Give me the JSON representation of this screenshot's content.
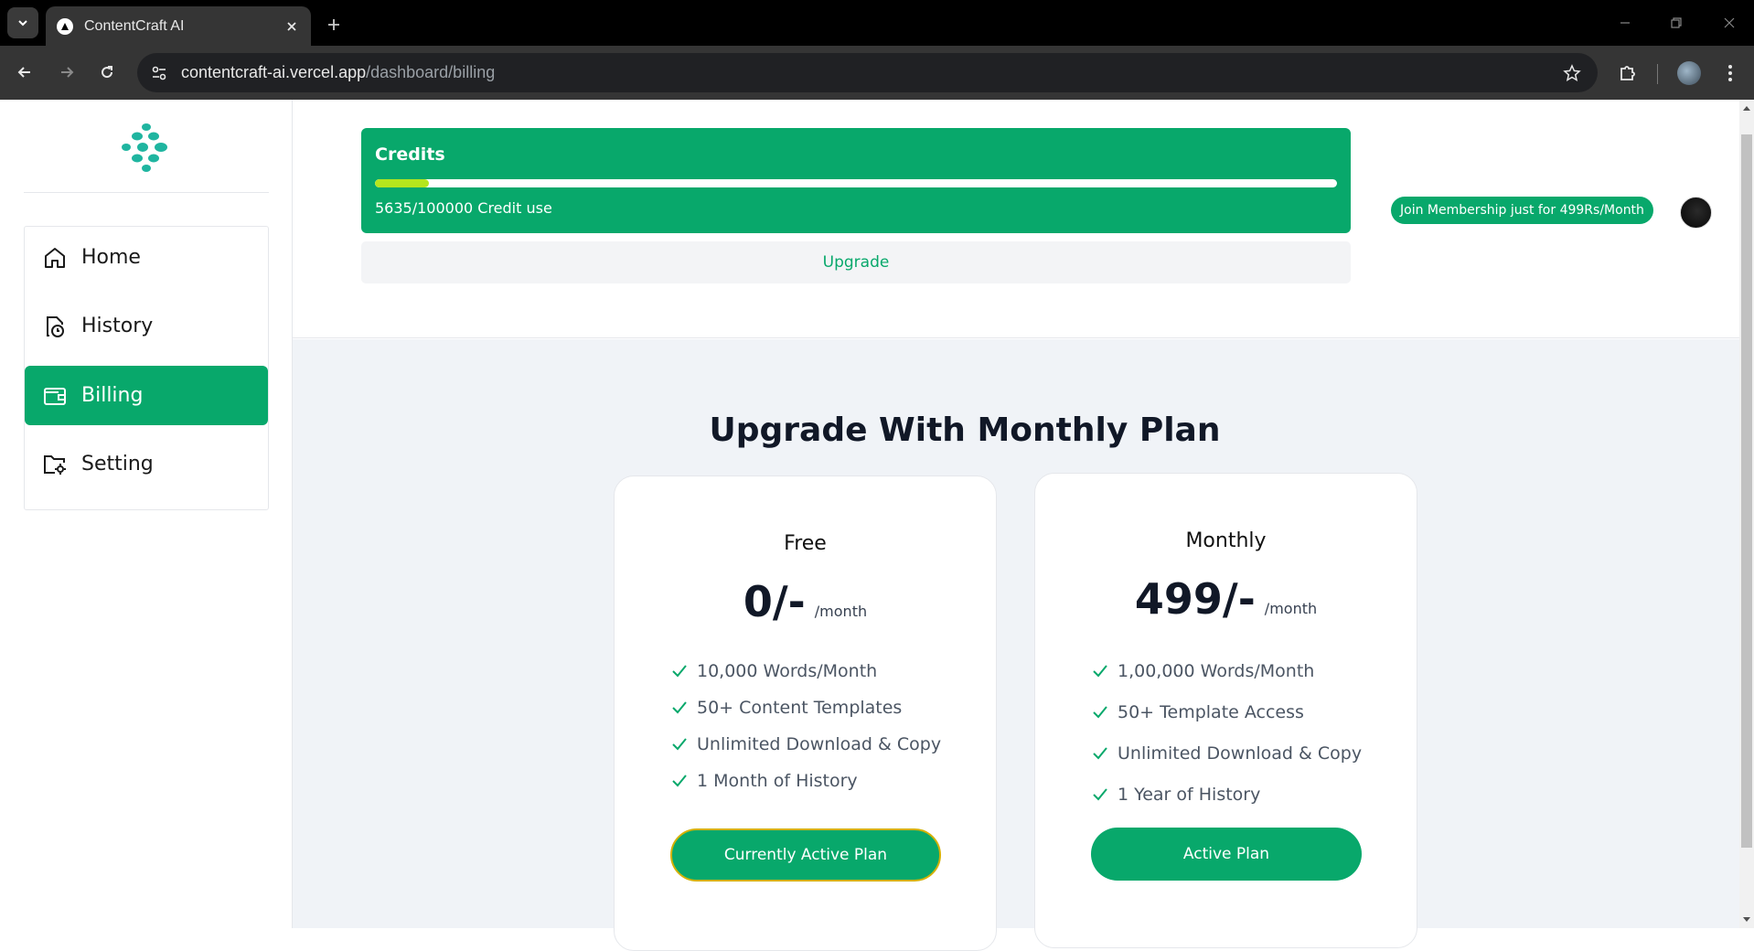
{
  "browser": {
    "tab_title": "ContentCraft AI",
    "url_host": "contentcraft-ai.vercel.app",
    "url_path": "/dashboard/billing"
  },
  "sidebar": {
    "items": [
      {
        "label": "Home",
        "icon": "home-icon"
      },
      {
        "label": "History",
        "icon": "history-icon"
      },
      {
        "label": "Billing",
        "icon": "wallet-icon",
        "active": true
      },
      {
        "label": "Setting",
        "icon": "folder-settings-icon"
      }
    ]
  },
  "credits": {
    "title": "Credits",
    "usage_text": "5635/100000 Credit use",
    "used": 5635,
    "total": 100000,
    "upgrade_label": "Upgrade"
  },
  "header": {
    "membership_label": "Join Membership just for 499Rs/Month"
  },
  "plans": {
    "heading": "Upgrade With Monthly Plan",
    "items": [
      {
        "name": "Free",
        "price": "0/-",
        "period": "/month",
        "features": [
          "10,000 Words/Month",
          "50+ Content Templates",
          "Unlimited Download & Copy",
          "1 Month of History"
        ],
        "button_label": "Currently Active Plan"
      },
      {
        "name": "Monthly",
        "price": "499/-",
        "period": "/month",
        "features": [
          "1,00,000 Words/Month",
          "50+ Template Access",
          "Unlimited Download & Copy",
          "1 Year of History"
        ],
        "button_label": "Active Plan"
      }
    ]
  },
  "colors": {
    "brand_green": "#08a86b",
    "progress_fill": "#b5e61d",
    "plans_background": "#f0f3f7"
  }
}
